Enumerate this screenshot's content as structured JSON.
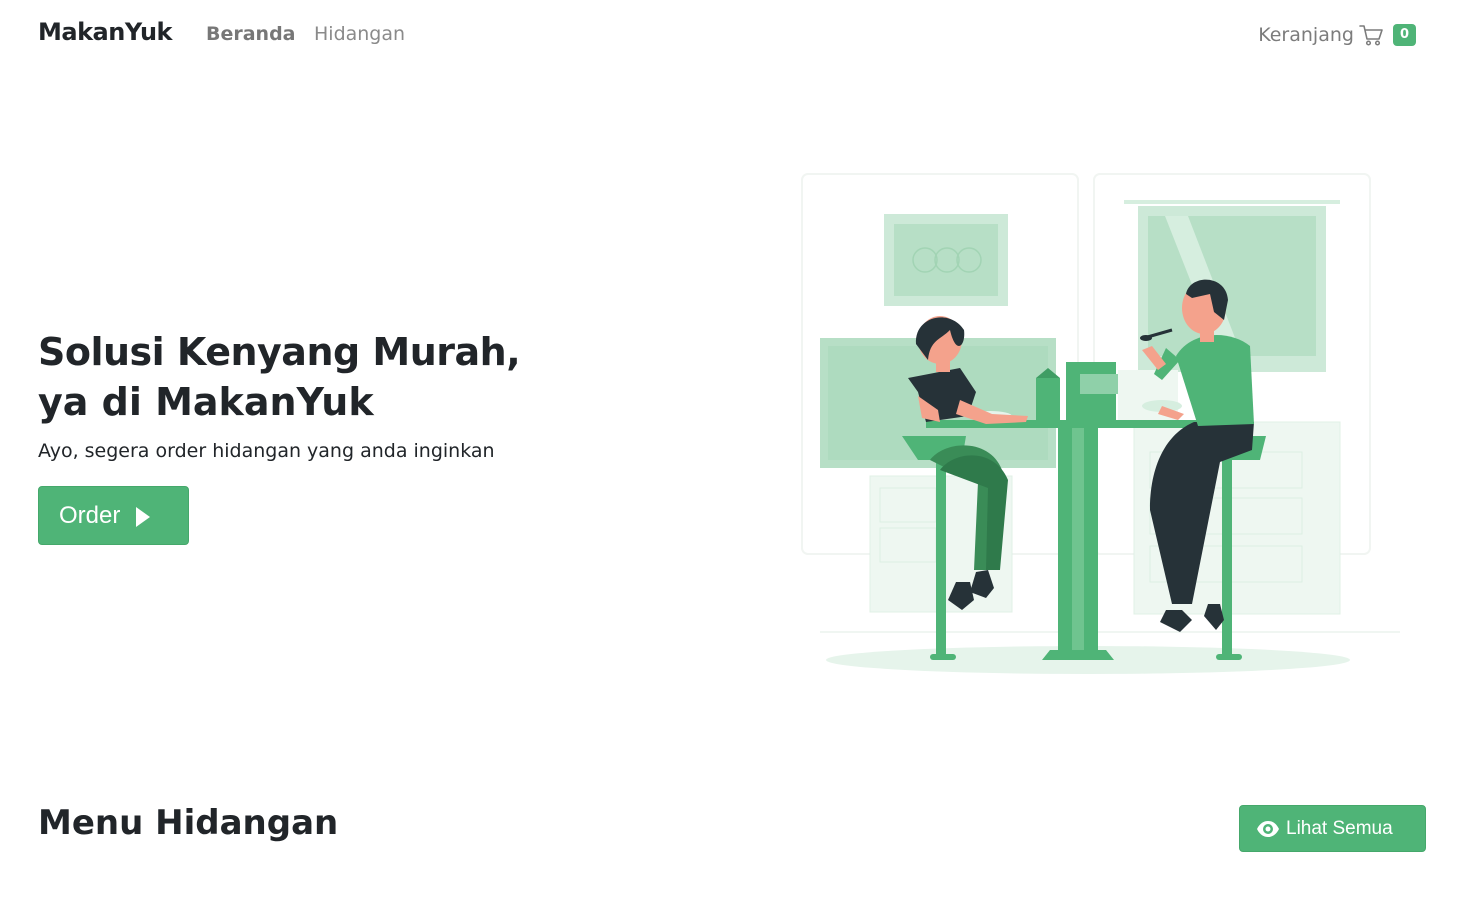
{
  "navbar": {
    "brand": "MakanYuk",
    "links": [
      "Beranda",
      "Hidangan"
    ],
    "cart_label": "Keranjang",
    "cart_count": "0",
    "cart_icon": "cart-icon"
  },
  "hero": {
    "title": "Solusi Kenyang Murah,",
    "subtitle": "ya di MakanYuk",
    "description": "Ayo, segera order hidangan yang anda inginkan",
    "order_label": "Order",
    "order_icon": "play-icon",
    "illustration": "people-eating-illustration"
  },
  "menu_section": {
    "title_light": "Menu",
    "title_bold": "Hidangan",
    "see_all_label": "Lihat Semua",
    "see_all_icon": "eye-icon"
  },
  "colors": {
    "accent": "#4fb477",
    "text": "#212529",
    "muted": "#8a8a8a",
    "dark_clothing": "#263238",
    "skin": "#f4a28c"
  }
}
